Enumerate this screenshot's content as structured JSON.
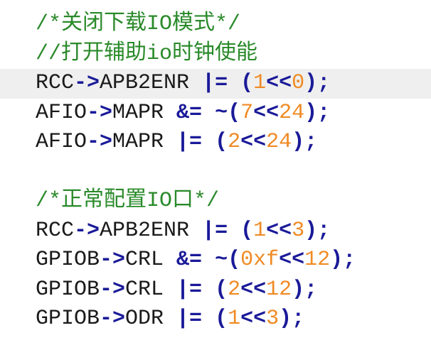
{
  "colors": {
    "comment": "#2a8a2a",
    "identifier": "#1a1a1a",
    "operator": "#1a1a99",
    "number": "#f08a24",
    "current_line_bg": "#efefef",
    "background": "#ffffff"
  },
  "lines": [
    {
      "current": false,
      "tokens": [
        {
          "t": "comment",
          "v": "/*关闭下载IO模式*/"
        }
      ]
    },
    {
      "current": false,
      "tokens": [
        {
          "t": "comment",
          "v": "//打开辅助io时钟使能"
        }
      ]
    },
    {
      "current": true,
      "tokens": [
        {
          "t": "ident",
          "v": "RCC"
        },
        {
          "t": "op",
          "v": "->"
        },
        {
          "t": "ident",
          "v": "APB2ENR "
        },
        {
          "t": "op",
          "v": "|="
        },
        {
          "t": "ident",
          "v": " "
        },
        {
          "t": "op",
          "v": "("
        },
        {
          "t": "num",
          "v": "1"
        },
        {
          "t": "op",
          "v": "<<"
        },
        {
          "t": "num",
          "v": "0"
        },
        {
          "t": "op",
          "v": ");"
        }
      ]
    },
    {
      "current": false,
      "tokens": [
        {
          "t": "ident",
          "v": "AFIO"
        },
        {
          "t": "op",
          "v": "->"
        },
        {
          "t": "ident",
          "v": "MAPR "
        },
        {
          "t": "op",
          "v": "&="
        },
        {
          "t": "ident",
          "v": " "
        },
        {
          "t": "op",
          "v": "~("
        },
        {
          "t": "num",
          "v": "7"
        },
        {
          "t": "op",
          "v": "<<"
        },
        {
          "t": "num",
          "v": "24"
        },
        {
          "t": "op",
          "v": ");"
        }
      ]
    },
    {
      "current": false,
      "tokens": [
        {
          "t": "ident",
          "v": "AFIO"
        },
        {
          "t": "op",
          "v": "->"
        },
        {
          "t": "ident",
          "v": "MAPR "
        },
        {
          "t": "op",
          "v": "|="
        },
        {
          "t": "ident",
          "v": " "
        },
        {
          "t": "op",
          "v": "("
        },
        {
          "t": "num",
          "v": "2"
        },
        {
          "t": "op",
          "v": "<<"
        },
        {
          "t": "num",
          "v": "24"
        },
        {
          "t": "op",
          "v": ");"
        }
      ]
    },
    {
      "current": false,
      "tokens": []
    },
    {
      "current": false,
      "tokens": [
        {
          "t": "comment",
          "v": "/*正常配置IO口*/"
        }
      ]
    },
    {
      "current": false,
      "tokens": [
        {
          "t": "ident",
          "v": "RCC"
        },
        {
          "t": "op",
          "v": "->"
        },
        {
          "t": "ident",
          "v": "APB2ENR "
        },
        {
          "t": "op",
          "v": "|="
        },
        {
          "t": "ident",
          "v": " "
        },
        {
          "t": "op",
          "v": "("
        },
        {
          "t": "num",
          "v": "1"
        },
        {
          "t": "op",
          "v": "<<"
        },
        {
          "t": "num",
          "v": "3"
        },
        {
          "t": "op",
          "v": ");"
        }
      ]
    },
    {
      "current": false,
      "tokens": [
        {
          "t": "ident",
          "v": "GPIOB"
        },
        {
          "t": "op",
          "v": "->"
        },
        {
          "t": "ident",
          "v": "CRL "
        },
        {
          "t": "op",
          "v": "&="
        },
        {
          "t": "ident",
          "v": " "
        },
        {
          "t": "op",
          "v": "~("
        },
        {
          "t": "num",
          "v": "0xf"
        },
        {
          "t": "op",
          "v": "<<"
        },
        {
          "t": "num",
          "v": "12"
        },
        {
          "t": "op",
          "v": ");"
        }
      ]
    },
    {
      "current": false,
      "tokens": [
        {
          "t": "ident",
          "v": "GPIOB"
        },
        {
          "t": "op",
          "v": "->"
        },
        {
          "t": "ident",
          "v": "CRL "
        },
        {
          "t": "op",
          "v": "|="
        },
        {
          "t": "ident",
          "v": " "
        },
        {
          "t": "op",
          "v": "("
        },
        {
          "t": "num",
          "v": "2"
        },
        {
          "t": "op",
          "v": "<<"
        },
        {
          "t": "num",
          "v": "12"
        },
        {
          "t": "op",
          "v": ");"
        }
      ]
    },
    {
      "current": false,
      "tokens": [
        {
          "t": "ident",
          "v": "GPIOB"
        },
        {
          "t": "op",
          "v": "->"
        },
        {
          "t": "ident",
          "v": "ODR "
        },
        {
          "t": "op",
          "v": "|="
        },
        {
          "t": "ident",
          "v": " "
        },
        {
          "t": "op",
          "v": "("
        },
        {
          "t": "num",
          "v": "1"
        },
        {
          "t": "op",
          "v": "<<"
        },
        {
          "t": "num",
          "v": "3"
        },
        {
          "t": "op",
          "v": ");"
        }
      ]
    }
  ]
}
